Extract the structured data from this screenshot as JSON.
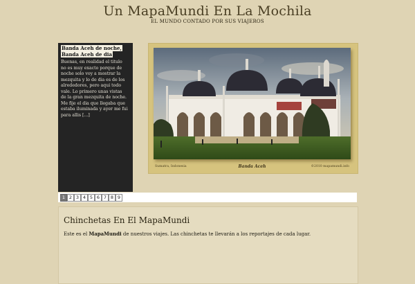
{
  "site": {
    "title": "Un MapaMundi En La Mochila",
    "tagline": "EL MUNDO CONTADO POR SUS VIAJEROS"
  },
  "featured": {
    "post_title": "Banda Aceh de noche, Banda Aceh de dia",
    "excerpt": "Buenas, en realidad el titulo no es muy exacto porque de noche solo voy a mostrar la mezquita y lo de dia es de los alrededores, pero aqui todo vale. Lo primero unas vistas de la gran mezquita de noche. Me fije el dia que llegaba que estaba iluminada y ayer me fui para allis [...]",
    "caption_left": "Sumatra, Indonesia",
    "caption_center": "Banda Aceh",
    "caption_right": "©2010 mapamundi.info"
  },
  "pager": {
    "pages": [
      "1",
      "2",
      "3",
      "4",
      "5",
      "6",
      "7",
      "8",
      "9"
    ],
    "current": "1"
  },
  "content": {
    "heading": "Chinchetas En El MapaMundi",
    "text_before": "Este es el ",
    "text_bold": "MapaMundi",
    "text_after": " de nuestros viajes. Las chinchetas te llevarán a los reportajes de cada lugar."
  }
}
